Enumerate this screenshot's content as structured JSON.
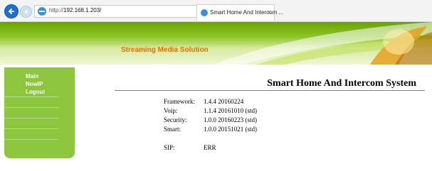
{
  "browser": {
    "url_prefix": "http://",
    "url_host": "192.168.1.203/",
    "address_tools": "⌕ ▾ ↻",
    "tab_title": "Smart Home And Intercom ...",
    "tab_close": "×"
  },
  "banner": {
    "tagline": "Streaming Media Solution"
  },
  "sidebar": {
    "items": [
      {
        "label": "Main"
      },
      {
        "label": "NowIP"
      },
      {
        "label": "Logout"
      }
    ]
  },
  "main": {
    "title": "Smart Home And Intercom System",
    "versions": [
      {
        "label": "Framework:",
        "value": "1.4.4 20160224"
      },
      {
        "label": "Voip:",
        "value": "1.1.4 20161010 (std)"
      },
      {
        "label": "Security:",
        "value": "1.0.0 20160223 (std)"
      },
      {
        "label": "Smart:",
        "value": "1.0.0 20151021 (std)"
      }
    ],
    "sip": {
      "label": "SIP:",
      "value": "ERR"
    }
  },
  "colors": {
    "banner_green": "#8cc628",
    "sidebar_green": "#8cc63f",
    "tagline_orange": "#e46f00"
  }
}
